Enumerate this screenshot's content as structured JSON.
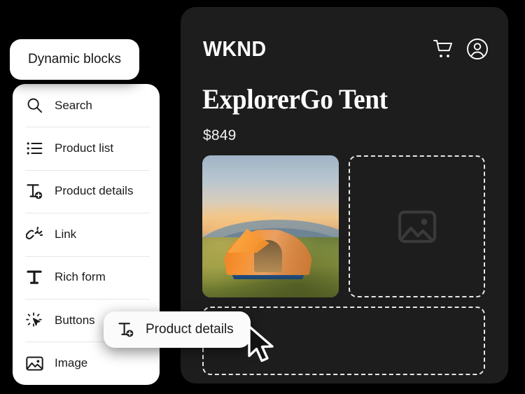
{
  "colors": {
    "page_background": "#000000",
    "panel_dark": "#1d1d1d",
    "panel_light": "#ffffff",
    "text_light": "#ffffff",
    "text_dark": "#1b1b1b",
    "placeholder_border": "#e8e8e8",
    "divider": "#e6e6e6"
  },
  "dynamic_blocks_pill": {
    "label": "Dynamic blocks"
  },
  "blocks_panel": {
    "items": [
      {
        "label": "Search",
        "icon": "search-icon"
      },
      {
        "label": "Product list",
        "icon": "list-icon"
      },
      {
        "label": "Product details",
        "icon": "text-add-icon"
      },
      {
        "label": "Link",
        "icon": "link-icon"
      },
      {
        "label": "Rich form",
        "icon": "text-icon"
      },
      {
        "label": "Buttons",
        "icon": "cursor-sparkle-icon"
      },
      {
        "label": "Image",
        "icon": "image-icon"
      }
    ]
  },
  "hover_chip": {
    "label": "Product details",
    "icon": "text-add-icon",
    "cursor": "arrow-pointer-cursor"
  },
  "preview": {
    "brand": "WKND",
    "header_icons": [
      {
        "name": "shopping-cart-icon"
      },
      {
        "name": "account-circle-icon"
      }
    ],
    "product_title": "ExplorerGo Tent",
    "product_price": "$849",
    "photo": {
      "alt": "orange dome tent pitched on a grassy ridge at sunrise with layered blue mountains"
    },
    "placeholders": [
      {
        "name": "image-placeholder-right",
        "icon": "image-icon"
      },
      {
        "name": "content-placeholder-bottom",
        "icon": ""
      }
    ]
  }
}
